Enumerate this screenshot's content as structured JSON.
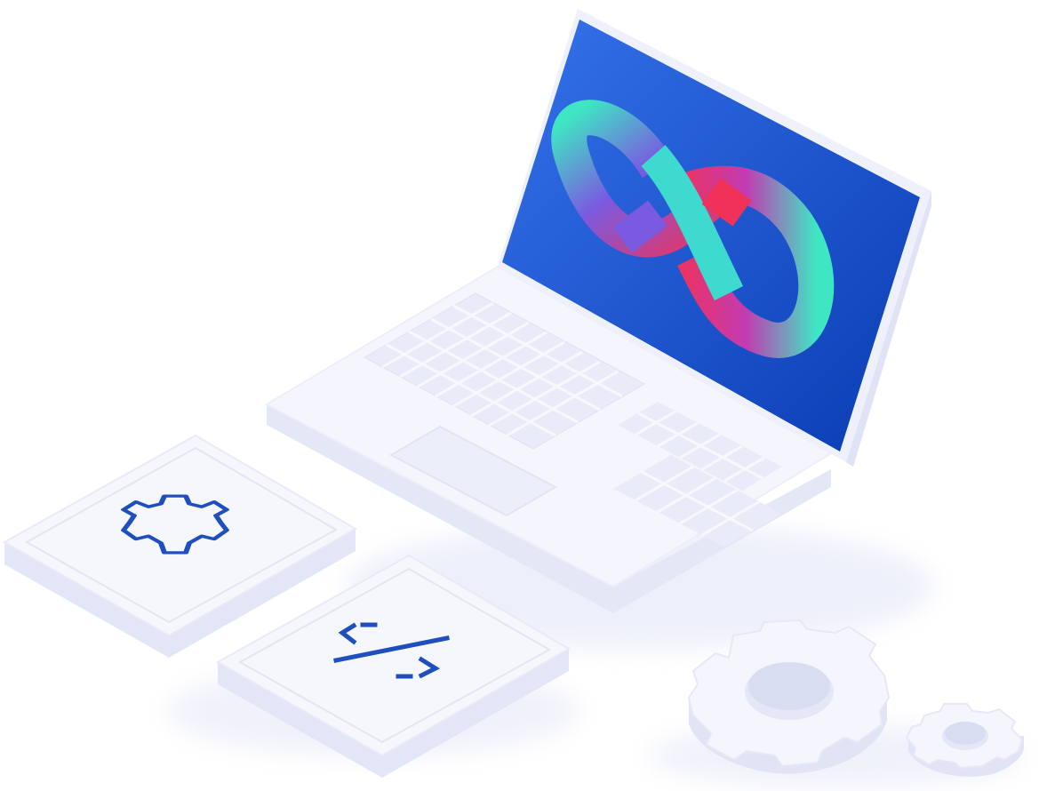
{
  "illustration": {
    "subject": "devops-illustration",
    "colors": {
      "screen_top": "#2f6fe6",
      "screen_bottom": "#0a3fb8",
      "loop_teal": "#3ee6c4",
      "loop_magenta": "#d43aa8",
      "loop_red": "#f0325a",
      "loop_purple": "#8a4fd8",
      "device_body": "#f4f5fc",
      "device_shadow": "#e2e5f5",
      "icon_blue": "#1f4fbf"
    },
    "icons": [
      "infinity-loop-icon",
      "gear-outline-icon",
      "code-brackets-icon",
      "large-gear-icon",
      "small-gear-icon"
    ]
  }
}
